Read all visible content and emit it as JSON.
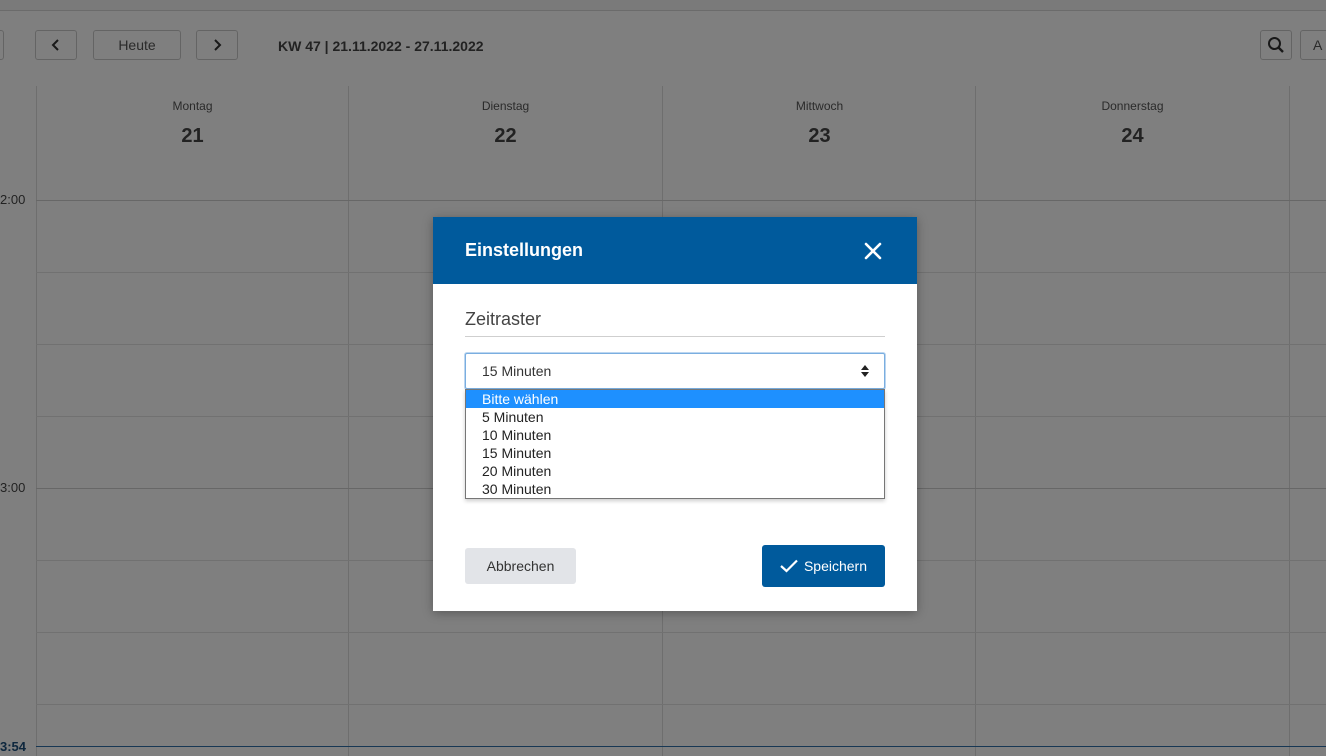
{
  "toolbar": {
    "today_label": "Heute",
    "week_label": "KW 47 | 21.11.2022 - 27.11.2022",
    "right_partial_label": "A"
  },
  "calendar": {
    "days": [
      {
        "name": "Montag",
        "num": "21"
      },
      {
        "name": "Dienstag",
        "num": "22"
      },
      {
        "name": "Mittwoch",
        "num": "23"
      },
      {
        "name": "Donnerstag",
        "num": "24"
      }
    ],
    "time_labels": [
      "2:00",
      "3:00"
    ],
    "now_label": "3:54"
  },
  "modal": {
    "title": "Einstellungen",
    "section_title": "Zeitraster",
    "select_value": "15 Minuten",
    "options": [
      "Bitte wählen",
      "5 Minuten",
      "10 Minuten",
      "15 Minuten",
      "20 Minuten",
      "30 Minuten"
    ],
    "highlighted_option_index": 0,
    "cancel_label": "Abbrechen",
    "save_label": "Speichern"
  },
  "colors": {
    "primary": "#005a9c",
    "highlight": "#1e90ff"
  }
}
